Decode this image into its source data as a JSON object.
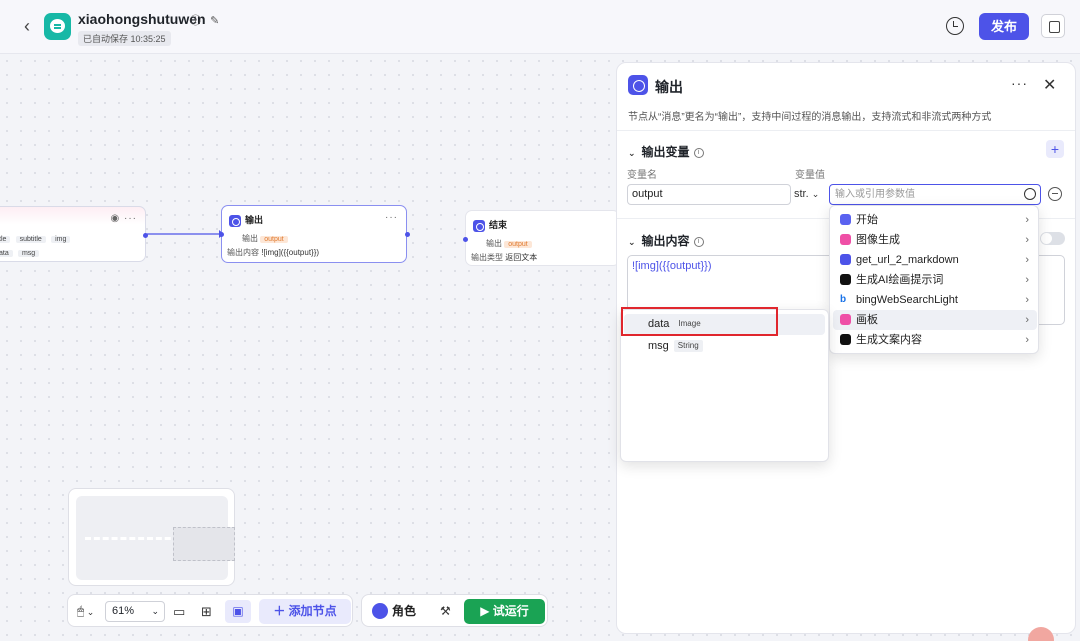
{
  "header": {
    "app_name": "xiaohongshutuwen",
    "autosave": "已自动保存 10:35:25",
    "publish_label": "发布"
  },
  "canvas": {
    "node_left": {
      "row1": [
        "tle",
        "subtitle",
        "img"
      ],
      "row2": [
        "ata",
        "msg"
      ]
    },
    "node_output": {
      "title": "输出",
      "output_label": "输出",
      "output_value": "output",
      "content_label": "输出内容",
      "content_value": "![img]({{output}})"
    },
    "node_end": {
      "title": "结束",
      "output_label": "输出",
      "output_value": "output",
      "type_label": "输出类型",
      "type_value": "返回文本"
    }
  },
  "toolbar": {
    "zoom": "61%",
    "add_node_label": "添加节点",
    "role_label": "角色",
    "run_label": "试运行"
  },
  "panel": {
    "title": "输出",
    "description": "节点从“消息”更名为“输出”，支持中间过程的消息输出，支持流式和非流式两种方式",
    "section_vars": "输出变量",
    "col_name": "变量名",
    "col_value": "变量值",
    "var_name": "output",
    "var_type": "str.",
    "value_placeholder": "输入或引用参数值",
    "section_content": "输出内容",
    "content": "![img]({{output}})"
  },
  "node_menu": [
    {
      "label": "开始",
      "color": "#5a62f0"
    },
    {
      "label": "图像生成",
      "color": "#ef4fa6"
    },
    {
      "label": "get_url_2_markdown",
      "color": "#4d53e8"
    },
    {
      "label": "生成AI绘画提示词",
      "color": "#111111"
    },
    {
      "label": "bingWebSearchLight",
      "color": "#1a73e8"
    },
    {
      "label": "画板",
      "color": "#ef4fa6"
    },
    {
      "label": "生成文案内容",
      "color": "#111111"
    }
  ],
  "var_menu": [
    {
      "name": "data",
      "type": "Image"
    },
    {
      "name": "msg",
      "type": "String"
    }
  ]
}
